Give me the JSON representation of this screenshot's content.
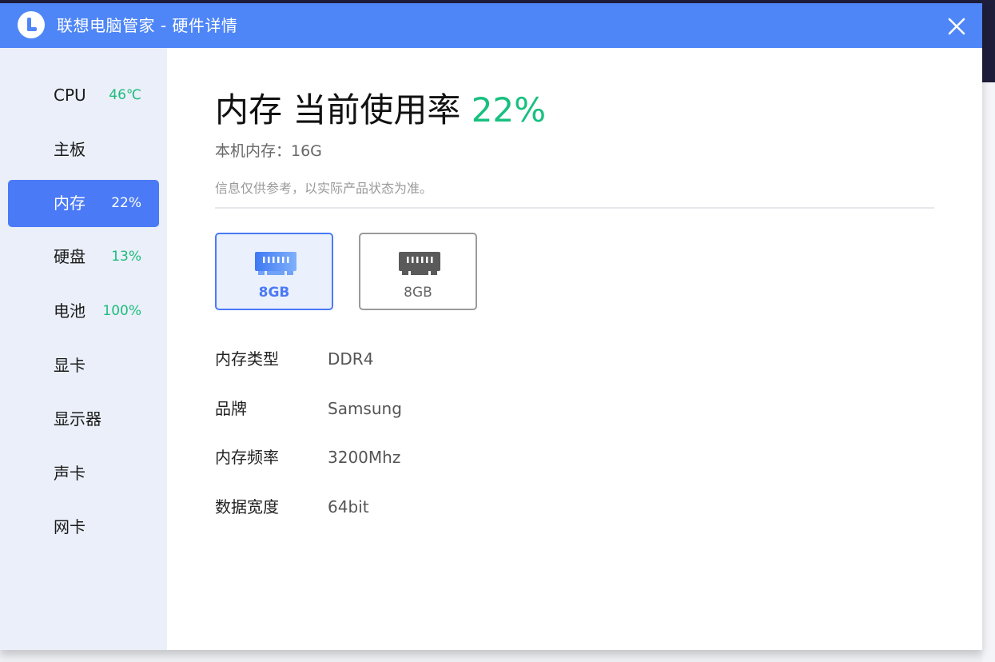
{
  "window": {
    "title": "联想电脑管家 - 硬件详情"
  },
  "sidebar": {
    "items": [
      {
        "label": "CPU",
        "value": "46℃"
      },
      {
        "label": "主板",
        "value": ""
      },
      {
        "label": "内存",
        "value": "22%"
      },
      {
        "label": "硬盘",
        "value": "13%"
      },
      {
        "label": "电池",
        "value": "100%"
      },
      {
        "label": "显卡",
        "value": ""
      },
      {
        "label": "显示器",
        "value": ""
      },
      {
        "label": "声卡",
        "value": ""
      },
      {
        "label": "网卡",
        "value": ""
      }
    ],
    "active_index": 2
  },
  "main": {
    "heading_prefix": "内存 当前使用率 ",
    "heading_percent": "22%",
    "total_memory": "本机内存：16G",
    "note": "信息仅供参考，以实际产品状态为准。",
    "modules": [
      {
        "label": "8GB",
        "selected": true
      },
      {
        "label": "8GB",
        "selected": false
      }
    ],
    "specs": [
      {
        "key": "内存类型",
        "value": "DDR4"
      },
      {
        "key": "品牌",
        "value": "Samsung"
      },
      {
        "key": "内存频率",
        "value": "3200Mhz"
      },
      {
        "key": "数据宽度",
        "value": "64bit"
      }
    ]
  },
  "colors": {
    "titlebar": "#4f86f7",
    "accent": "#4a7af5",
    "green": "#18c07f"
  },
  "icons": {
    "logo": "lenovo-l-logo-icon",
    "close": "close-icon",
    "module": "memory-module-icon"
  }
}
